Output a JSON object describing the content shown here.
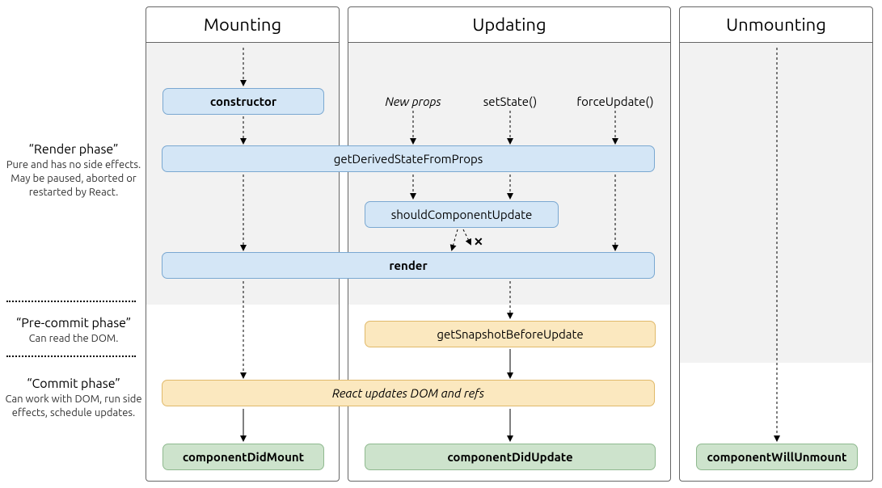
{
  "phases": {
    "render": {
      "title": "“Render phase”",
      "desc": "Pure and has no side effects. May be paused, aborted or restarted by React."
    },
    "preCommit": {
      "title": "“Pre-commit phase”",
      "desc": "Can read the DOM."
    },
    "commit": {
      "title": "“Commit phase”",
      "desc": "Can work with DOM, run side effects, schedule updates."
    }
  },
  "columns": {
    "mounting": "Mounting",
    "updating": "Updating",
    "unmounting": "Unmounting"
  },
  "nodes": {
    "constructor": "constructor",
    "gdsfp": "getDerivedStateFromProps",
    "scu": "shouldComponentUpdate",
    "render": "render",
    "gsbu": "getSnapshotBeforeUpdate",
    "updateDom": "React updates DOM and refs",
    "cdm": "componentDidMount",
    "cdu": "componentDidUpdate",
    "cwu": "componentWillUnmount"
  },
  "triggers": {
    "newProps": "New props",
    "setState": "setState()",
    "forceUpdate": "forceUpdate()"
  },
  "cross": "✕"
}
